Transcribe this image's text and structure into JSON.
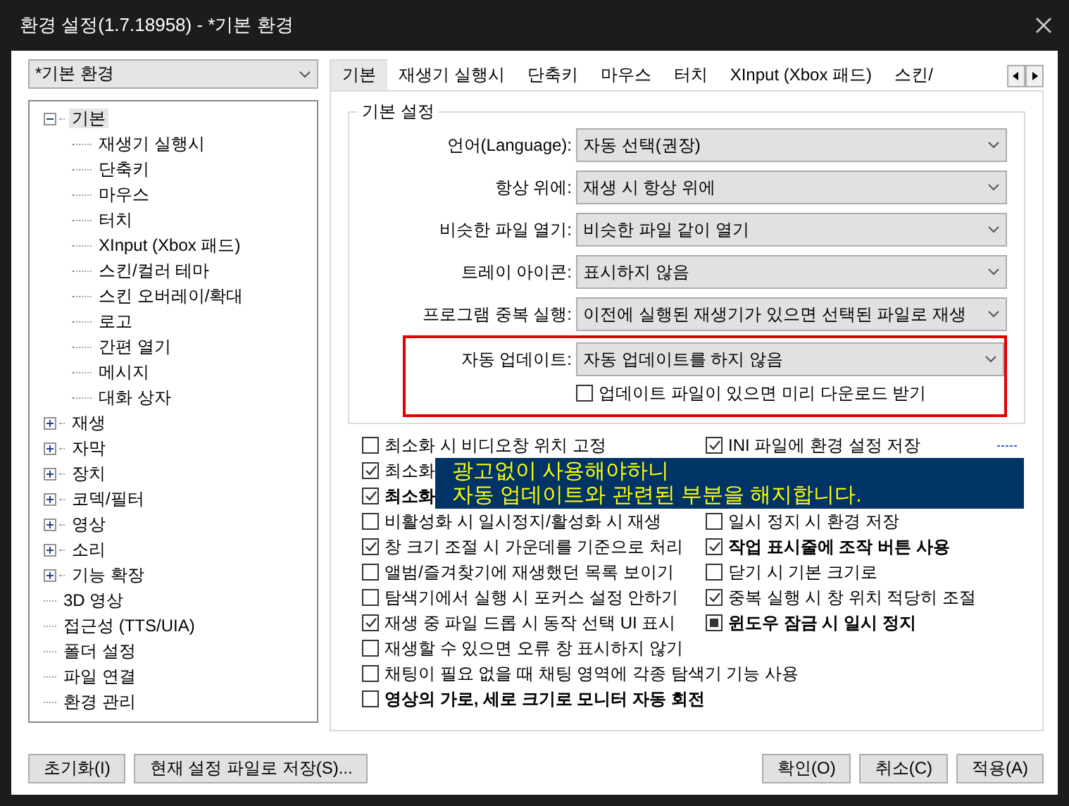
{
  "window": {
    "title": "환경 설정(1.7.18958) - *기본 환경"
  },
  "profile": {
    "value": "*기본 환경"
  },
  "tree": [
    {
      "label": "기본",
      "selected": true,
      "expanded": true,
      "children": [
        {
          "label": "재생기 실행시",
          "selected": false
        },
        {
          "label": "단축키",
          "selected": false
        },
        {
          "label": "마우스",
          "selected": false
        },
        {
          "label": "터치",
          "selected": false
        },
        {
          "label": "XInput (Xbox 패드)",
          "selected": false
        },
        {
          "label": "스킨/컬러 테마",
          "selected": false
        },
        {
          "label": "스킨 오버레이/확대",
          "selected": false
        },
        {
          "label": "로고",
          "selected": false
        },
        {
          "label": "간편 열기",
          "selected": false
        },
        {
          "label": "메시지",
          "selected": false
        },
        {
          "label": "대화 상자",
          "selected": false
        }
      ]
    },
    {
      "label": "재생",
      "selected": false,
      "expanded": false
    },
    {
      "label": "자막",
      "selected": false,
      "expanded": false
    },
    {
      "label": "장치",
      "selected": false,
      "expanded": false
    },
    {
      "label": "코덱/필터",
      "selected": false,
      "expanded": false
    },
    {
      "label": "영상",
      "selected": false,
      "expanded": false
    },
    {
      "label": "소리",
      "selected": false,
      "expanded": false
    },
    {
      "label": "기능 확장",
      "selected": false,
      "expanded": false
    },
    {
      "label": "3D 영상",
      "selected": false
    },
    {
      "label": "접근성 (TTS/UIA)",
      "selected": false
    },
    {
      "label": "폴더 설정",
      "selected": false
    },
    {
      "label": "파일 연결",
      "selected": false
    },
    {
      "label": "환경 관리",
      "selected": false
    }
  ],
  "tabs": [
    {
      "label": "기본",
      "selected": true
    },
    {
      "label": "재생기 실행시",
      "selected": false
    },
    {
      "label": "단축키",
      "selected": false
    },
    {
      "label": "마우스",
      "selected": false
    },
    {
      "label": "터치",
      "selected": false
    },
    {
      "label": "XInput (Xbox 패드)",
      "selected": false
    },
    {
      "label": "스킨/",
      "selected": false
    }
  ],
  "group": {
    "title": "기본 설정",
    "fields": [
      {
        "label": "언어(Language):",
        "value": "자동 선택(권장)"
      },
      {
        "label": "항상 위에:",
        "value": "재생 시 항상 위에"
      },
      {
        "label": "비슷한 파일 열기:",
        "value": "비슷한 파일 같이 열기"
      },
      {
        "label": "트레이 아이콘:",
        "value": "표시하지 않음"
      },
      {
        "label": "프로그램 중복 실행:",
        "value": "이전에 실행된 재생기가 있으면 선택된 파일로 재생"
      }
    ],
    "auto_update": {
      "label": "자동 업데이트:",
      "value": "자동 업데이트를 하지 않음",
      "option": {
        "label": "업데이트 파일이 있으면 미리 다운로드 받기",
        "checked": false
      }
    }
  },
  "options": [
    {
      "left": {
        "label": "최소화 시 비디오창 위치 고정",
        "checked": false,
        "bold": false
      },
      "right": {
        "label": "INI 파일에 환경 설정 저장",
        "checked": true,
        "bold": false
      }
    },
    {
      "left": {
        "label": "최소화",
        "checked": true,
        "bold": false
      }
    },
    {
      "left": {
        "label": "최소화",
        "checked": true,
        "bold": true
      }
    },
    {
      "left": {
        "label": "비활성화 시 일시정지/활성화 시 재생",
        "checked": false,
        "bold": false
      },
      "right": {
        "label": "일시 정지 시 환경 저장",
        "checked": false,
        "bold": false
      }
    },
    {
      "left": {
        "label": "창 크기 조절 시 가운데를 기준으로 처리",
        "checked": true,
        "bold": false
      },
      "right": {
        "label": "작업 표시줄에 조작 버튼 사용",
        "checked": true,
        "bold": true
      }
    },
    {
      "left": {
        "label": "앨범/즐겨찾기에 재생했던 목록 보이기",
        "checked": false,
        "bold": false
      },
      "right": {
        "label": "닫기 시 기본 크기로",
        "checked": false,
        "bold": false
      }
    },
    {
      "left": {
        "label": "탐색기에서 실행 시 포커스 설정 안하기",
        "checked": false,
        "bold": false
      },
      "right": {
        "label": "중복 실행 시 창 위치 적당히 조절",
        "checked": true,
        "bold": false
      }
    },
    {
      "left": {
        "label": "재생 중 파일 드롭 시 동작 선택 UI 표시",
        "checked": true,
        "bold": false
      },
      "right": {
        "label": "윈도우 잠금 시 일시 정지",
        "checked": false,
        "mixed": true,
        "bold": true
      }
    },
    {
      "left": {
        "label": "재생할 수 있으면 오류 창 표시하지 않기",
        "checked": false,
        "bold": false
      }
    },
    {
      "left": {
        "label": "채팅이 필요 없을 때 채팅 영역에 각종 탐색기 기능 사용",
        "checked": false,
        "bold": false
      }
    },
    {
      "left": {
        "label": "영상의 가로, 세로 크기로 모니터 자동 회전",
        "checked": false,
        "bold": true
      }
    }
  ],
  "annotation": {
    "lines": [
      "광고없이 사용해야하니",
      "자동 업데이트와 관련된 부분을 해지합니다."
    ]
  },
  "buttons_left": [
    "초기화(I)",
    "현재 설정 파일로 저장(S)..."
  ],
  "buttons_right": [
    "확인(O)",
    "취소(C)",
    "적용(A)"
  ]
}
